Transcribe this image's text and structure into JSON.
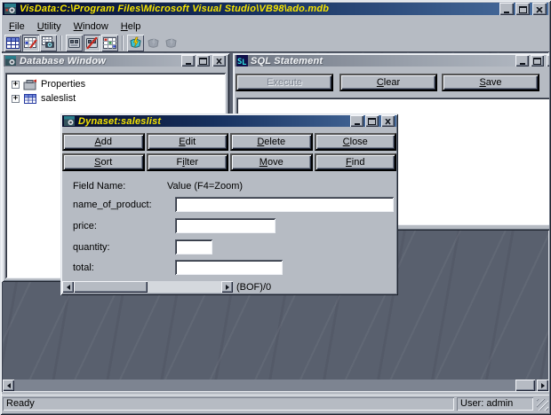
{
  "window": {
    "title": "VisData:C:\\Program Files\\Microsoft Visual Studio\\VB98\\ado.mdb"
  },
  "menu": {
    "items": [
      {
        "t": "File",
        "u": 0
      },
      {
        "t": "Utility",
        "u": 0
      },
      {
        "t": "Window",
        "u": 0
      },
      {
        "t": "Help",
        "u": 0
      }
    ]
  },
  "toolbar": {
    "buttons": [
      {
        "name": "table-type-recordset",
        "state": "raised"
      },
      {
        "name": "dynaset-type-recordset",
        "state": "pressed"
      },
      {
        "name": "snapshot-type-recordset",
        "state": "raised"
      },
      {
        "name": "use-data-control-on-form",
        "state": "raised"
      },
      {
        "name": "dont-use-data-control",
        "state": "pressed"
      },
      {
        "name": "use-dbgrid-control",
        "state": "raised"
      },
      {
        "name": "begin-transaction",
        "state": "raised"
      },
      {
        "name": "rollback-transaction",
        "state": "disabled"
      },
      {
        "name": "commit-transaction",
        "state": "disabled"
      }
    ]
  },
  "database_window": {
    "title": "Database Window",
    "tree": [
      {
        "label": "Properties",
        "icon": "properties-icon"
      },
      {
        "label": "saleslist",
        "icon": "table-icon"
      }
    ]
  },
  "sql_window": {
    "title": "SQL Statement",
    "buttons": [
      {
        "t": "Execute",
        "u": -1,
        "disabled": true
      },
      {
        "t": "Clear",
        "u": 0,
        "disabled": false
      },
      {
        "t": "Save",
        "u": 0,
        "disabled": false
      }
    ],
    "statement_text": ""
  },
  "dynaset": {
    "title": "Dynaset:saleslist",
    "buttons": [
      {
        "t": "Add",
        "u": 0
      },
      {
        "t": "Edit",
        "u": 0
      },
      {
        "t": "Delete",
        "u": 0
      },
      {
        "t": "Close",
        "u": 0
      },
      {
        "t": "Sort",
        "u": 0
      },
      {
        "t": "Filter",
        "u": 1
      },
      {
        "t": "Move",
        "u": 0
      },
      {
        "t": "Find",
        "u": 0
      }
    ],
    "field_name_header": "Field Name:",
    "value_header": "Value (F4=Zoom)",
    "fields": [
      {
        "label": "name_of_product:",
        "value": ""
      },
      {
        "label": "price:",
        "value": ""
      },
      {
        "label": "quantity:",
        "value": ""
      },
      {
        "label": "total:",
        "value": ""
      }
    ],
    "record_status": "(BOF)/0"
  },
  "statusbar": {
    "left": "Ready",
    "right": "User: admin"
  },
  "colors": {
    "titlebar_active_start": "#070e2d",
    "titlebar_active_end": "#4a6fa0",
    "titlebar_text": "#f6e400",
    "mdi_background": "#59606e",
    "window_face": "#b6bbc3"
  }
}
